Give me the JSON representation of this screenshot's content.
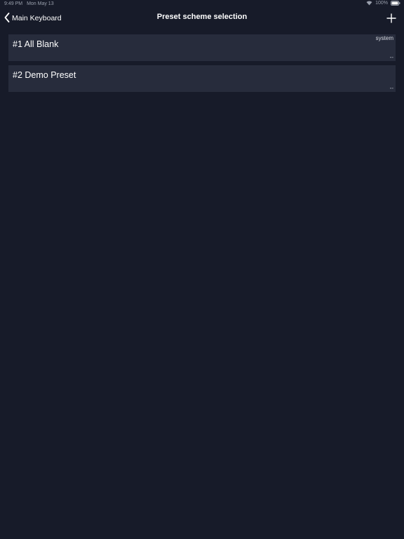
{
  "status_bar": {
    "time": "9:49 PM",
    "date": "Mon May 13",
    "battery": "100%"
  },
  "nav": {
    "back_label": "Main Keyboard",
    "title": "Preset scheme selection",
    "add_icon": "plus-icon"
  },
  "presets": [
    {
      "name": "#1 All Blank",
      "tag": "system",
      "detail": "--"
    },
    {
      "name": "#2 Demo Preset",
      "tag": "",
      "detail": "--"
    }
  ],
  "colors": {
    "background": "#171b29",
    "row_background": "#272c3c",
    "text": "#ffffff"
  }
}
